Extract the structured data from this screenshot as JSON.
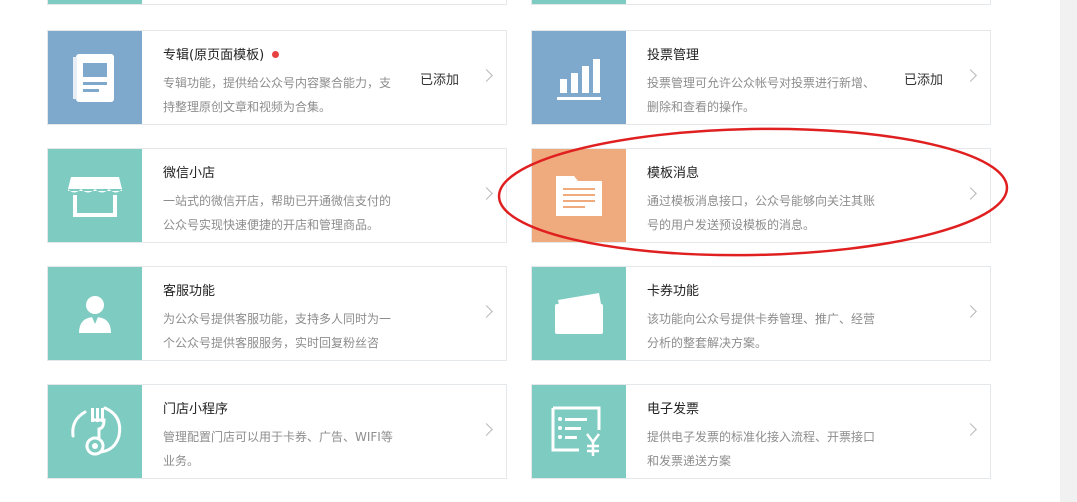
{
  "colors": {
    "teal": "#7ecbc1",
    "blue": "#7ea8cc",
    "orange": "#efab7d",
    "annotation_red": "#e02020"
  },
  "cards": [
    {
      "title": "专辑(原页面模板)",
      "has_red_dot": true,
      "desc": "专辑功能，提供给公众号内容聚合能力，支持整理原创文章和视频为合集。",
      "status": "已添加",
      "icon": "album-icon",
      "color": "#7ea8cc"
    },
    {
      "title": "投票管理",
      "has_red_dot": false,
      "desc": "投票管理可允许公众帐号对投票进行新增、删除和查看的操作。",
      "status": "已添加",
      "icon": "vote-chart-icon",
      "color": "#7ea8cc"
    },
    {
      "title": "微信小店",
      "has_red_dot": false,
      "desc": "一站式的微信开店，帮助已开通微信支付的公众号实现快速便捷的开店和管理商品。",
      "status": "",
      "icon": "store-icon",
      "color": "#7ecbc1"
    },
    {
      "title": "模板消息",
      "has_red_dot": false,
      "desc": "通过模板消息接口，公众号能够向关注其账号的用户发送预设模板的消息。",
      "status": "",
      "icon": "template-message-icon",
      "color": "#efab7d"
    },
    {
      "title": "客服功能",
      "has_red_dot": false,
      "desc": "为公众号提供客服功能，支持多人同时为一个公众号提供客服服务，实时回复粉丝咨",
      "status": "",
      "icon": "customer-service-icon",
      "color": "#7ecbc1"
    },
    {
      "title": "卡券功能",
      "has_red_dot": false,
      "desc": "该功能向公众号提供卡券管理、推广、经营分析的整套解决方案。",
      "status": "",
      "icon": "card-coupon-icon",
      "color": "#7ecbc1"
    },
    {
      "title": "门店小程序",
      "has_red_dot": false,
      "desc": "管理配置门店可以用于卡券、广告、WIFI等业务。",
      "status": "",
      "icon": "store-miniprogram-icon",
      "color": "#7ecbc1"
    },
    {
      "title": "电子发票",
      "has_red_dot": false,
      "desc": "提供电子发票的标准化接入流程、开票接口和发票递送方案",
      "status": "",
      "icon": "e-invoice-icon",
      "color": "#7ecbc1"
    }
  ]
}
